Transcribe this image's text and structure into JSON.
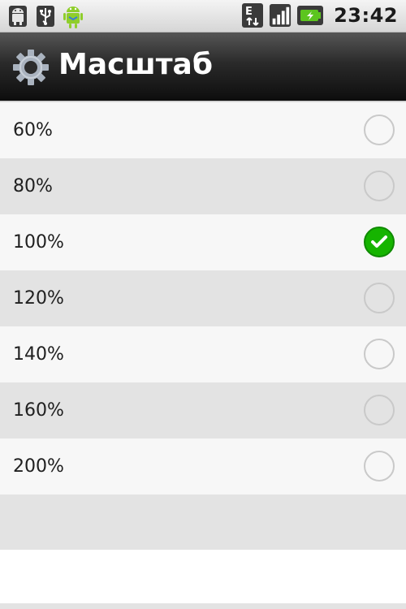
{
  "statusbar": {
    "icons_left": [
      "android-notification-icon",
      "usb-icon",
      "debug-android-icon"
    ],
    "icons_right": [
      "edge-network-icon",
      "signal-icon",
      "battery-icon"
    ],
    "network_letter": "E",
    "time": "23:42"
  },
  "header": {
    "icon": "gear-icon",
    "title": "Масштаб"
  },
  "options": [
    {
      "label": "60%",
      "selected": false
    },
    {
      "label": "80%",
      "selected": false
    },
    {
      "label": "100%",
      "selected": true
    },
    {
      "label": "120%",
      "selected": false
    },
    {
      "label": "140%",
      "selected": false
    },
    {
      "label": "160%",
      "selected": false
    },
    {
      "label": "200%",
      "selected": false
    }
  ],
  "colors": {
    "check": "#16b400",
    "row_light": "#f7f7f7",
    "row_dark": "#e3e3e3"
  }
}
